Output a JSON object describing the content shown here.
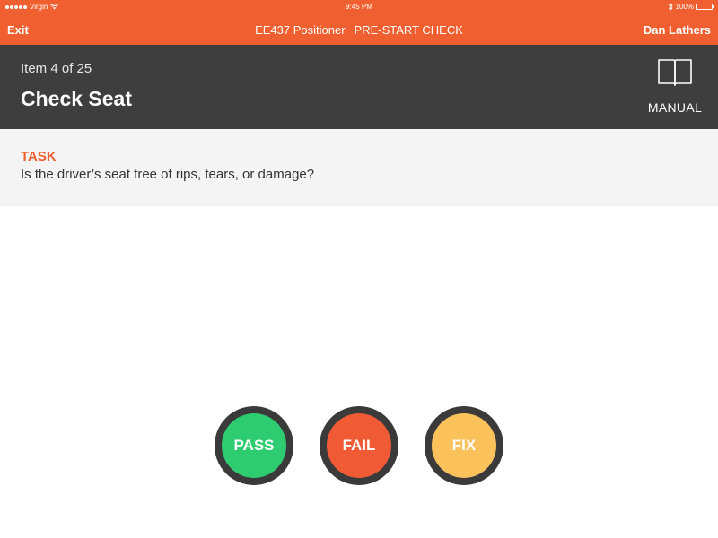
{
  "status_bar": {
    "carrier": "Virgin",
    "time": "9:45 PM",
    "battery": "100%",
    "icons": [
      "signal-dots-icon",
      "wifi-icon",
      "bluetooth-icon",
      "battery-icon"
    ]
  },
  "nav": {
    "exit_label": "Exit",
    "asset": "EE437 Positioner",
    "check_type": "PRE-START CHECK",
    "user": "Dan Lathers"
  },
  "item": {
    "counter": "Item 4 of 25",
    "title": "Check Seat",
    "manual_label": "MANUAL",
    "manual_icon": "book-icon"
  },
  "task": {
    "label": "TASK",
    "question": "Is the driver’s seat free of rips, tears, or damage?"
  },
  "actions": {
    "pass": "PASS",
    "fail": "FAIL",
    "fix": "FIX"
  },
  "colors": {
    "brand_orange": "#f05f2f",
    "header_dark": "#3e3e3e",
    "pass_green": "#2ecc71",
    "fail_red": "#f05a35",
    "fix_yellow": "#fbc15a"
  }
}
